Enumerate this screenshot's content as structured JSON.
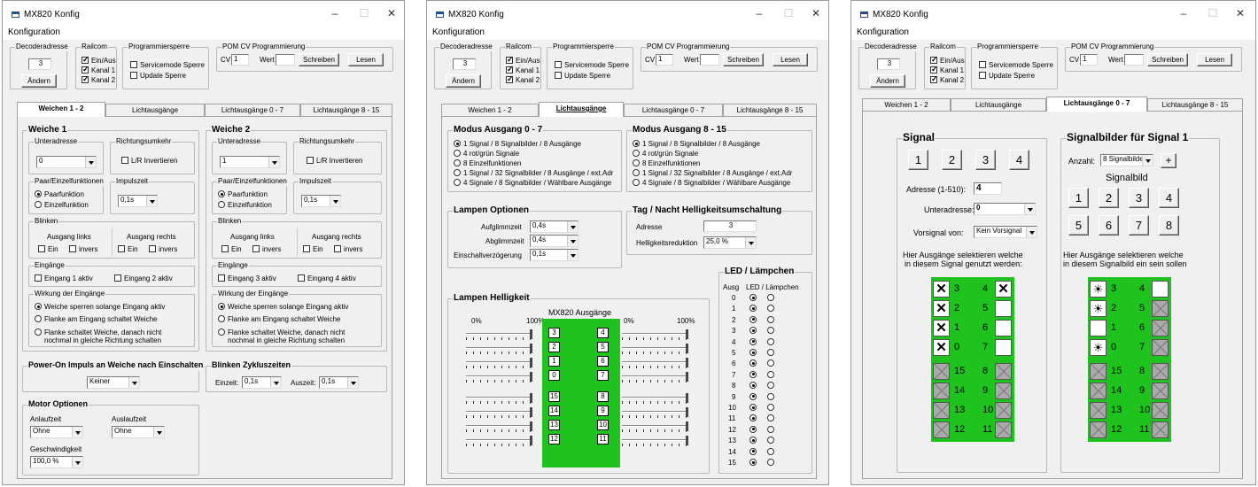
{
  "app_title": "MX820 Konfig",
  "menu": "Konfiguration",
  "header": {
    "decoder_group": "Decoderadresse",
    "decoder_value": "3",
    "change_button": "Ändern",
    "railcom_group": "Railcom",
    "railcom_items": [
      "Ein/Aus",
      "Kanal 1",
      "Kanal 2"
    ],
    "prog_group": "Programmiersperre",
    "prog_items": [
      "Servicemode Sperre",
      "Update Sperre"
    ],
    "pom_group": "POM CV Programmierung",
    "cv_label": "CV",
    "cv_value": "1",
    "wert_label": "Wert",
    "wert_value": "",
    "write_button": "Schreiben",
    "read_button": "Lesen"
  },
  "tabs": [
    "Weichen 1 - 2",
    "Lichtausgänge",
    "Lichtausgänge 0 - 7",
    "Lichtausgänge 8 - 15"
  ],
  "w1": {
    "weiche1": "Weiche 1",
    "weiche2": "Weiche 2",
    "unteradresse": "Unteradresse",
    "ua1": "0",
    "ua2": "1",
    "richtung": "Richtungsumkehr",
    "lr": "L/R Invertieren",
    "paar": "Paar/Einzelfunktionen",
    "paarfunktion": "Paarfunktion",
    "einzelfunktion": "Einzelfunktion",
    "impulszeit": "Impulszeit",
    "impuls_value": "0,1s",
    "blinken": "Blinken",
    "ausgang_links": "Ausgang links",
    "ausgang_rechts": "Ausgang rechts",
    "ein": "Ein",
    "invers": "invers",
    "eingaenge": "Eingänge",
    "e1": "Eingang 1 aktiv",
    "e2": "Eingang 2 aktiv",
    "e3": "Eingang 3 aktiv",
    "e4": "Eingang 4 aktiv",
    "wirkung": "Wirkung der Eingänge",
    "wk1": "Weiche sperren solange Eingang aktiv",
    "wk2": "Flanke am Eingang schaltet Weiche",
    "wk3a": "Flanke schaltet Weiche, danach nicht",
    "wk3b": "nochmal in gleiche Richtung schalten",
    "poweron": "Power-On Impuls an Weiche nach Einschalten",
    "poweron_value": "Keiner",
    "blinkzyklus": "Blinken Zykluszeiten",
    "einzeit": "Einzeit:",
    "einzeit_value": "0,1s",
    "auszeit": "Auszeit:",
    "auszeit_value": "0,1s",
    "motor": "Motor Optionen",
    "anlaufzeit": "Anlaufzeit",
    "anlauf_value": "Ohne",
    "auslaufzeit": "Auslaufzeit",
    "auslauf_value": "Ohne",
    "geschw": "Geschwindigkeit",
    "geschw_value": "100,0 %"
  },
  "w2": {
    "modus07": "Modus Ausgang 0 - 7",
    "modus815": "Modus Ausgang 8 - 15",
    "modes": [
      "1 Signal / 8 Signalbilder / 8 Ausgänge",
      "4 rot/grün Signale",
      "8 Einzelfunktionen",
      "1 Signal / 32 Signalbilder / 8 Ausgänge / ext.Adr",
      "4 Signale / 8 Signalbilder / Wählbare Ausgänge"
    ],
    "lampen_opt": "Lampen Optionen",
    "aufglimm": "Aufglimmzeit",
    "aufglimm_v": "0,4s",
    "abglimm": "Abglimmzeit",
    "abglimm_v": "0,4s",
    "einschalt": "Einschaltverzögerung",
    "einschalt_v": "0,1s",
    "tagnacht": "Tag / Nacht Helligkeitsumschaltung",
    "adresse": "Adresse",
    "adresse_v": "3",
    "helligkeit": "Helligkeitsreduktion",
    "helligkeit_v": "25,0 %",
    "led": "LED / Lämpchen",
    "ausg": "Ausg",
    "led_col": "LED / Lämpchen",
    "led_rows": [
      "0",
      "1",
      "2",
      "3",
      "4",
      "5",
      "6",
      "7",
      "8",
      "9",
      "10",
      "11",
      "12",
      "13",
      "14",
      "15"
    ],
    "lampen_hell": "Lampen Helligkeit",
    "pct0": "0%",
    "pct100": "100%",
    "mx_title": "MX820 Ausgänge",
    "left_nums": [
      "3",
      "2",
      "1",
      "0",
      "15",
      "14",
      "13",
      "12"
    ],
    "right_nums": [
      "4",
      "5",
      "6",
      "7",
      "8",
      "9",
      "10",
      "11"
    ]
  },
  "w3": {
    "signal": "Signal",
    "sig_buttons": [
      "1",
      "2",
      "3",
      "4"
    ],
    "adresse": "Adresse (1-510):",
    "adresse_v": "4",
    "unteradresse": "Unteradresse:",
    "ua_v": "0",
    "vorsignal": "Vorsignal von:",
    "vorsignal_v": "Kein Vorsignal",
    "info_left1": "Hier Ausgänge selektieren welche",
    "info_left2": "in diesem Signal genutzt werden:",
    "signalbilder": "Signalbilder für Signal 1",
    "anzahl": "Anzahl:",
    "anzahl_v": "8 Signalbilder",
    "plus": "+",
    "signalbild": "Signalbild",
    "sb_buttons": [
      "1",
      "2",
      "3",
      "4",
      "5",
      "6",
      "7",
      "8"
    ],
    "info_right1": "Hier Ausgänge selektieren welche",
    "info_right2": "in diesem Signalbild ein sein sollen",
    "left_nums": [
      "3",
      "2",
      "1",
      "0",
      "15",
      "14",
      "13",
      "12"
    ],
    "right_nums": [
      "4",
      "5",
      "6",
      "7",
      "8",
      "9",
      "10",
      "11"
    ]
  }
}
